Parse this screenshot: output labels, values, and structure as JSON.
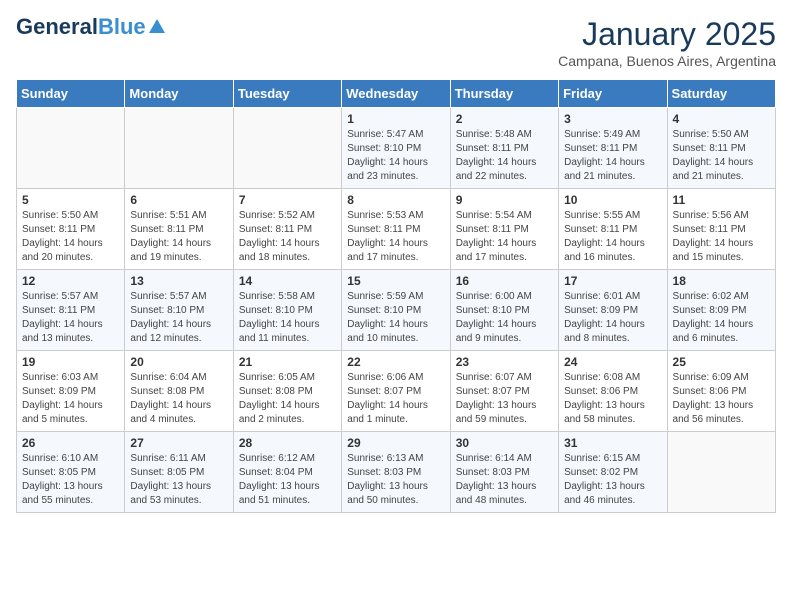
{
  "header": {
    "logo_line1": "General",
    "logo_line2": "Blue",
    "month": "January 2025",
    "location": "Campana, Buenos Aires, Argentina"
  },
  "days_of_week": [
    "Sunday",
    "Monday",
    "Tuesday",
    "Wednesday",
    "Thursday",
    "Friday",
    "Saturday"
  ],
  "weeks": [
    [
      {
        "day": "",
        "info": ""
      },
      {
        "day": "",
        "info": ""
      },
      {
        "day": "",
        "info": ""
      },
      {
        "day": "1",
        "info": "Sunrise: 5:47 AM\nSunset: 8:10 PM\nDaylight: 14 hours and 23 minutes."
      },
      {
        "day": "2",
        "info": "Sunrise: 5:48 AM\nSunset: 8:11 PM\nDaylight: 14 hours and 22 minutes."
      },
      {
        "day": "3",
        "info": "Sunrise: 5:49 AM\nSunset: 8:11 PM\nDaylight: 14 hours and 21 minutes."
      },
      {
        "day": "4",
        "info": "Sunrise: 5:50 AM\nSunset: 8:11 PM\nDaylight: 14 hours and 21 minutes."
      }
    ],
    [
      {
        "day": "5",
        "info": "Sunrise: 5:50 AM\nSunset: 8:11 PM\nDaylight: 14 hours and 20 minutes."
      },
      {
        "day": "6",
        "info": "Sunrise: 5:51 AM\nSunset: 8:11 PM\nDaylight: 14 hours and 19 minutes."
      },
      {
        "day": "7",
        "info": "Sunrise: 5:52 AM\nSunset: 8:11 PM\nDaylight: 14 hours and 18 minutes."
      },
      {
        "day": "8",
        "info": "Sunrise: 5:53 AM\nSunset: 8:11 PM\nDaylight: 14 hours and 17 minutes."
      },
      {
        "day": "9",
        "info": "Sunrise: 5:54 AM\nSunset: 8:11 PM\nDaylight: 14 hours and 17 minutes."
      },
      {
        "day": "10",
        "info": "Sunrise: 5:55 AM\nSunset: 8:11 PM\nDaylight: 14 hours and 16 minutes."
      },
      {
        "day": "11",
        "info": "Sunrise: 5:56 AM\nSunset: 8:11 PM\nDaylight: 14 hours and 15 minutes."
      }
    ],
    [
      {
        "day": "12",
        "info": "Sunrise: 5:57 AM\nSunset: 8:11 PM\nDaylight: 14 hours and 13 minutes."
      },
      {
        "day": "13",
        "info": "Sunrise: 5:57 AM\nSunset: 8:10 PM\nDaylight: 14 hours and 12 minutes."
      },
      {
        "day": "14",
        "info": "Sunrise: 5:58 AM\nSunset: 8:10 PM\nDaylight: 14 hours and 11 minutes."
      },
      {
        "day": "15",
        "info": "Sunrise: 5:59 AM\nSunset: 8:10 PM\nDaylight: 14 hours and 10 minutes."
      },
      {
        "day": "16",
        "info": "Sunrise: 6:00 AM\nSunset: 8:10 PM\nDaylight: 14 hours and 9 minutes."
      },
      {
        "day": "17",
        "info": "Sunrise: 6:01 AM\nSunset: 8:09 PM\nDaylight: 14 hours and 8 minutes."
      },
      {
        "day": "18",
        "info": "Sunrise: 6:02 AM\nSunset: 8:09 PM\nDaylight: 14 hours and 6 minutes."
      }
    ],
    [
      {
        "day": "19",
        "info": "Sunrise: 6:03 AM\nSunset: 8:09 PM\nDaylight: 14 hours and 5 minutes."
      },
      {
        "day": "20",
        "info": "Sunrise: 6:04 AM\nSunset: 8:08 PM\nDaylight: 14 hours and 4 minutes."
      },
      {
        "day": "21",
        "info": "Sunrise: 6:05 AM\nSunset: 8:08 PM\nDaylight: 14 hours and 2 minutes."
      },
      {
        "day": "22",
        "info": "Sunrise: 6:06 AM\nSunset: 8:07 PM\nDaylight: 14 hours and 1 minute."
      },
      {
        "day": "23",
        "info": "Sunrise: 6:07 AM\nSunset: 8:07 PM\nDaylight: 13 hours and 59 minutes."
      },
      {
        "day": "24",
        "info": "Sunrise: 6:08 AM\nSunset: 8:06 PM\nDaylight: 13 hours and 58 minutes."
      },
      {
        "day": "25",
        "info": "Sunrise: 6:09 AM\nSunset: 8:06 PM\nDaylight: 13 hours and 56 minutes."
      }
    ],
    [
      {
        "day": "26",
        "info": "Sunrise: 6:10 AM\nSunset: 8:05 PM\nDaylight: 13 hours and 55 minutes."
      },
      {
        "day": "27",
        "info": "Sunrise: 6:11 AM\nSunset: 8:05 PM\nDaylight: 13 hours and 53 minutes."
      },
      {
        "day": "28",
        "info": "Sunrise: 6:12 AM\nSunset: 8:04 PM\nDaylight: 13 hours and 51 minutes."
      },
      {
        "day": "29",
        "info": "Sunrise: 6:13 AM\nSunset: 8:03 PM\nDaylight: 13 hours and 50 minutes."
      },
      {
        "day": "30",
        "info": "Sunrise: 6:14 AM\nSunset: 8:03 PM\nDaylight: 13 hours and 48 minutes."
      },
      {
        "day": "31",
        "info": "Sunrise: 6:15 AM\nSunset: 8:02 PM\nDaylight: 13 hours and 46 minutes."
      },
      {
        "day": "",
        "info": ""
      }
    ]
  ]
}
